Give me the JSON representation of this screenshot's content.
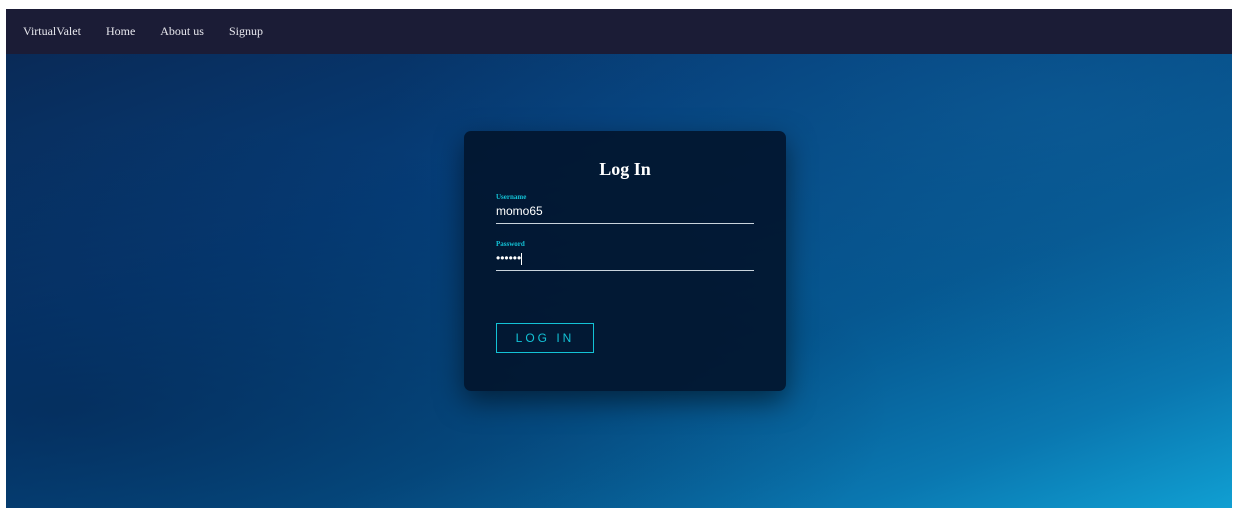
{
  "navbar": {
    "brand": "VirtualValet",
    "links": [
      {
        "label": "Home"
      },
      {
        "label": "About us"
      },
      {
        "label": "Signup"
      }
    ]
  },
  "login": {
    "title": "Log In",
    "username_label": "Username",
    "username_value": "momo65",
    "password_label": "Password",
    "password_value": "••••••",
    "button_label": "LOG IN"
  },
  "colors": {
    "navbar_bg": "#1b1c36",
    "accent": "#13c2d6",
    "card_bg": "#02162e"
  }
}
